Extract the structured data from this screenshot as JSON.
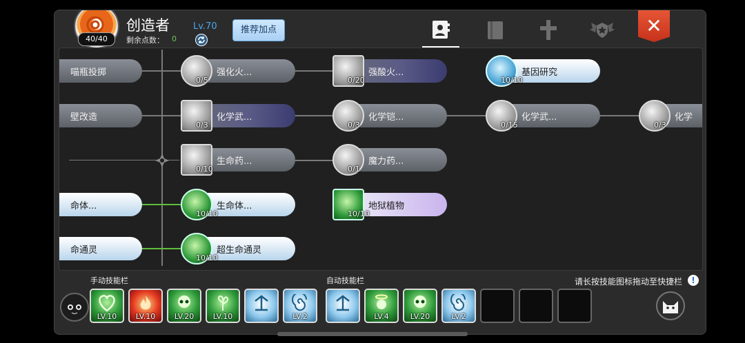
{
  "header": {
    "avatar_hp": "40/40",
    "name": "创造者",
    "points_label": "剩余点数：",
    "points_value": "0",
    "level": "Lv.70",
    "recommend_label": "推荐加点",
    "close_glyph": "✕",
    "tabs": [
      {
        "icon": "contact-book-icon",
        "active": true
      },
      {
        "icon": "book-icon",
        "active": false
      },
      {
        "icon": "cross-arrows-icon",
        "active": false
      },
      {
        "icon": "winged-emblem-icon",
        "active": false
      }
    ]
  },
  "tree": {
    "left_stubs": [
      "喵瓶投掷",
      "壁改造",
      "",
      "命体...",
      "命通灵"
    ],
    "nodes": [
      {
        "label": "强化火...",
        "count": "0/5",
        "style": "gray"
      },
      {
        "label": "强酸火...",
        "count": "0/20",
        "style": "purple"
      },
      {
        "label": "基因研究",
        "count": "10/10",
        "style": "blue"
      },
      {
        "label": "化学武...",
        "count": "0/3",
        "style": "purple"
      },
      {
        "label": "化学铠...",
        "count": "0/3",
        "style": "gray"
      },
      {
        "label": "化学武...",
        "count": "0/15",
        "style": "gray"
      },
      {
        "label": "化学",
        "count": "0/3",
        "style": "gray"
      },
      {
        "label": "生命药...",
        "count": "0/10",
        "style": "gray"
      },
      {
        "label": "魔力药...",
        "count": "0/1",
        "style": "gray"
      },
      {
        "label": "生命体...",
        "count": "10/10",
        "style": "blue"
      },
      {
        "label": "地狱植物",
        "count": "10/10",
        "style": "purple2"
      },
      {
        "label": "超生命通灵",
        "count": "10/10",
        "style": "blue"
      }
    ]
  },
  "skillbar": {
    "manual_title": "手动技能栏",
    "auto_title": "自动技能栏",
    "hint": "请长按技能图标拖动至快捷栏",
    "info_glyph": "!",
    "manual_slots": [
      {
        "level": "LV.10",
        "color": "green",
        "icon": "heart-skill-icon"
      },
      {
        "level": "LV.10",
        "color": "red",
        "icon": "fire-skill-icon"
      },
      {
        "level": "LV.20",
        "color": "green",
        "icon": "skull-skill-icon"
      },
      {
        "level": "LV.10",
        "color": "green",
        "icon": "plant-skill-icon"
      },
      {
        "level": "",
        "color": "blue",
        "icon": "summon-skill-icon"
      },
      {
        "level": "LV.2",
        "color": "blue",
        "icon": "swirl-skill-icon"
      }
    ],
    "auto_slots": [
      {
        "level": "",
        "color": "blue",
        "icon": "summon-skill-icon"
      },
      {
        "level": "LV.4",
        "color": "green",
        "icon": "angel-skill-icon"
      },
      {
        "level": "LV.20",
        "color": "green",
        "icon": "skull-skill-icon"
      },
      {
        "level": "LV.2",
        "color": "blue",
        "icon": "swirl-skill-icon"
      },
      {
        "level": "",
        "color": "empty",
        "icon": ""
      },
      {
        "level": "",
        "color": "empty",
        "icon": ""
      },
      {
        "level": "",
        "color": "empty",
        "icon": ""
      }
    ]
  }
}
